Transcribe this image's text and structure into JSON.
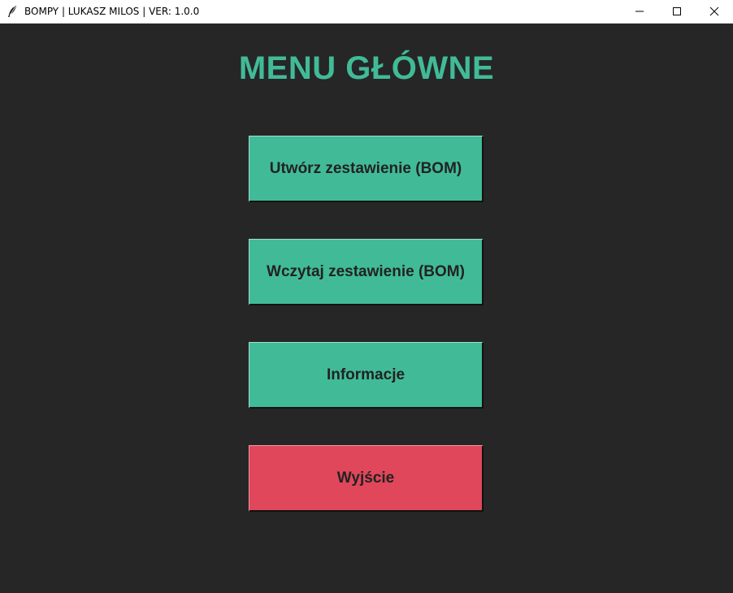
{
  "window": {
    "title": "BOMPY | LUKASZ MILOS | VER: 1.0.0",
    "icon": "feather-icon",
    "controls": [
      "minimize-icon",
      "maximize-icon",
      "close-icon"
    ]
  },
  "main": {
    "heading": "MENU GŁÓWNE",
    "buttons": [
      {
        "label": "Utwórz zestawienie (BOM)",
        "color": "#41bb97"
      },
      {
        "label": "Wczytaj zestawienie (BOM)",
        "color": "#41bb97"
      },
      {
        "label": "Informacje",
        "color": "#41bb97"
      },
      {
        "label": "Wyjście",
        "color": "#e0475a"
      }
    ]
  },
  "colors": {
    "background": "#262626",
    "accent": "#41bb97",
    "danger": "#e0475a",
    "button_text": "#222222"
  }
}
